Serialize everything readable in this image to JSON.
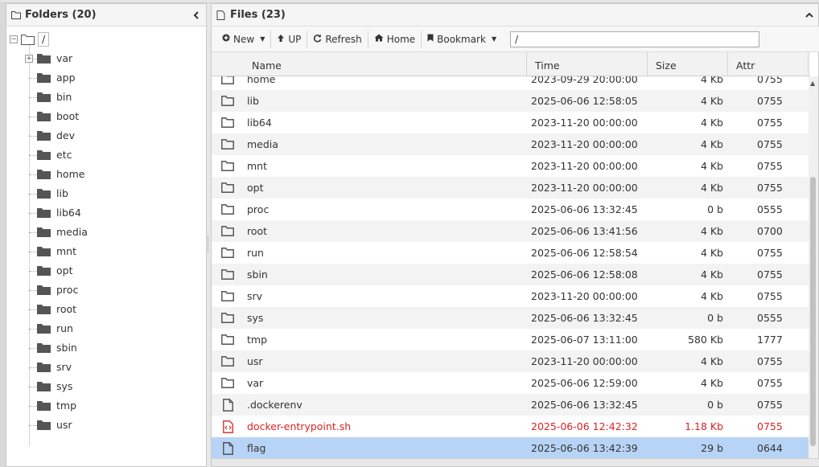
{
  "left_panel": {
    "title": "Folders (20)",
    "root_label": "/",
    "folders": [
      "var",
      "app",
      "bin",
      "boot",
      "dev",
      "etc",
      "home",
      "lib",
      "lib64",
      "media",
      "mnt",
      "opt",
      "proc",
      "root",
      "run",
      "sbin",
      "srv",
      "sys",
      "tmp",
      "usr"
    ]
  },
  "right_panel": {
    "title": "Files (23)",
    "toolbar": {
      "new_label": "New",
      "up_label": "UP",
      "refresh_label": "Refresh",
      "home_label": "Home",
      "bookmark_label": "Bookmark",
      "path_value": "/"
    },
    "columns": {
      "name": "Name",
      "time": "Time",
      "size": "Size",
      "attr": "Attr"
    },
    "files": [
      {
        "name": "home",
        "time": "2023-09-29 20:00:00",
        "size": "4 Kb",
        "attr": "0755",
        "type": "folder"
      },
      {
        "name": "lib",
        "time": "2025-06-06 12:58:05",
        "size": "4 Kb",
        "attr": "0755",
        "type": "folder"
      },
      {
        "name": "lib64",
        "time": "2023-11-20 00:00:00",
        "size": "4 Kb",
        "attr": "0755",
        "type": "folder"
      },
      {
        "name": "media",
        "time": "2023-11-20 00:00:00",
        "size": "4 Kb",
        "attr": "0755",
        "type": "folder"
      },
      {
        "name": "mnt",
        "time": "2023-11-20 00:00:00",
        "size": "4 Kb",
        "attr": "0755",
        "type": "folder"
      },
      {
        "name": "opt",
        "time": "2023-11-20 00:00:00",
        "size": "4 Kb",
        "attr": "0755",
        "type": "folder"
      },
      {
        "name": "proc",
        "time": "2025-06-06 13:32:45",
        "size": "0 b",
        "attr": "0555",
        "type": "folder"
      },
      {
        "name": "root",
        "time": "2025-06-06 13:41:56",
        "size": "4 Kb",
        "attr": "0700",
        "type": "folder"
      },
      {
        "name": "run",
        "time": "2025-06-06 12:58:54",
        "size": "4 Kb",
        "attr": "0755",
        "type": "folder"
      },
      {
        "name": "sbin",
        "time": "2025-06-06 12:58:08",
        "size": "4 Kb",
        "attr": "0755",
        "type": "folder"
      },
      {
        "name": "srv",
        "time": "2023-11-20 00:00:00",
        "size": "4 Kb",
        "attr": "0755",
        "type": "folder"
      },
      {
        "name": "sys",
        "time": "2025-06-06 13:32:45",
        "size": "0 b",
        "attr": "0555",
        "type": "folder"
      },
      {
        "name": "tmp",
        "time": "2025-06-07 13:11:00",
        "size": "580 Kb",
        "attr": "1777",
        "type": "folder"
      },
      {
        "name": "usr",
        "time": "2023-11-20 00:00:00",
        "size": "4 Kb",
        "attr": "0755",
        "type": "folder"
      },
      {
        "name": "var",
        "time": "2025-06-06 12:59:00",
        "size": "4 Kb",
        "attr": "0755",
        "type": "folder"
      },
      {
        "name": ".dockerenv",
        "time": "2025-06-06 13:32:45",
        "size": "0 b",
        "attr": "0755",
        "type": "file"
      },
      {
        "name": "docker-entrypoint.sh",
        "time": "2025-06-06 12:42:32",
        "size": "1.18 Kb",
        "attr": "0755",
        "type": "script",
        "highlight": "red"
      },
      {
        "name": "flag",
        "time": "2025-06-06 13:42:39",
        "size": "29 b",
        "attr": "0644",
        "type": "file",
        "selected": true
      }
    ]
  },
  "colors": {
    "selected_row": "#b7d4f6",
    "alert_text": "#dd2222",
    "alt_row": "#f3f3f3"
  },
  "icons": [
    "folder-outline-icon",
    "folder-solid-icon",
    "file-icon",
    "script-file-icon",
    "chevron-left-icon",
    "chevron-up-icon",
    "plus-circle-icon",
    "arrow-up-icon",
    "refresh-icon",
    "home-icon",
    "bookmark-icon",
    "caret-down-icon"
  ]
}
